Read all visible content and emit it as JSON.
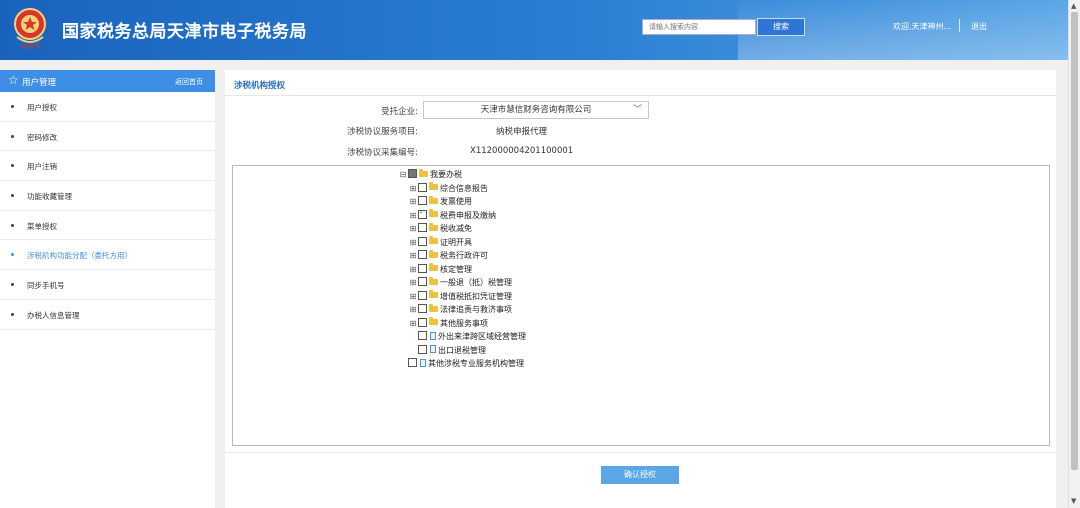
{
  "header": {
    "site_title": "国家税务总局天津市电子税务局",
    "emblem_text": "中国税务",
    "search_placeholder": "请输入搜索内容",
    "search_button": "搜索",
    "welcome": "欢迎,天津神州...",
    "logout": "退出",
    "colors": {
      "bar_start": "#1a63bd",
      "bar_end": "#5aa6e6"
    }
  },
  "sidebar": {
    "title": "用户管理",
    "home_link": "返回首页",
    "items": [
      {
        "label": "用户授权",
        "active": false
      },
      {
        "label": "密码修改",
        "active": false
      },
      {
        "label": "用户注销",
        "active": false
      },
      {
        "label": "功能收藏管理",
        "active": false
      },
      {
        "label": "菜单授权",
        "active": false
      },
      {
        "label": "涉税机构功能分配（委托方用）",
        "active": true
      },
      {
        "label": "同步手机号",
        "active": false
      },
      {
        "label": "办税人信息管理",
        "active": false
      }
    ]
  },
  "main": {
    "panel_title": "涉税机构授权",
    "form": {
      "client_label": "受托企业:",
      "client_value": "天津市慧信财务咨询有限公司",
      "service_label": "涉税协议服务项目:",
      "service_value": "纳税申报代理",
      "agreement_label": "涉税协议采集编号:",
      "agreement_value": "X112000004201100001"
    },
    "tree": [
      {
        "level": 0,
        "expander": "⊟",
        "check": "partial",
        "icon": "folder",
        "label": "我要办税"
      },
      {
        "level": 1,
        "expander": "⊞",
        "check": "none",
        "icon": "folder",
        "label": "综合信息报告"
      },
      {
        "level": 1,
        "expander": "⊞",
        "check": "none",
        "icon": "folder",
        "label": "发票使用"
      },
      {
        "level": 1,
        "expander": "⊞",
        "check": "checked",
        "icon": "folder",
        "label": "税费申报及缴纳"
      },
      {
        "level": 1,
        "expander": "⊞",
        "check": "none",
        "icon": "folder",
        "label": "税收减免"
      },
      {
        "level": 1,
        "expander": "⊞",
        "check": "none",
        "icon": "folder",
        "label": "证明开具"
      },
      {
        "level": 1,
        "expander": "⊞",
        "check": "none",
        "icon": "folder",
        "label": "税务行政许可"
      },
      {
        "level": 1,
        "expander": "⊞",
        "check": "none",
        "icon": "folder",
        "label": "核定管理"
      },
      {
        "level": 1,
        "expander": "⊞",
        "check": "none",
        "icon": "folder",
        "label": "一般退（抵）税管理"
      },
      {
        "level": 1,
        "expander": "⊞",
        "check": "none",
        "icon": "folder",
        "label": "增值税抵扣凭证管理"
      },
      {
        "level": 1,
        "expander": "⊞",
        "check": "none",
        "icon": "folder",
        "label": "法律追责与救济事项"
      },
      {
        "level": 1,
        "expander": "⊞",
        "check": "none",
        "icon": "folder",
        "label": "其他服务事项"
      },
      {
        "level": 1,
        "expander": "",
        "check": "none",
        "icon": "doc",
        "label": "外出来津跨区域经营管理"
      },
      {
        "level": 1,
        "expander": "",
        "check": "none",
        "icon": "doc",
        "label": "出口退税管理"
      },
      {
        "level": 0,
        "expander": "",
        "check": "none",
        "icon": "doc",
        "label": "其他涉税专业服务机构管理"
      }
    ],
    "confirm_button": "确认授权"
  }
}
